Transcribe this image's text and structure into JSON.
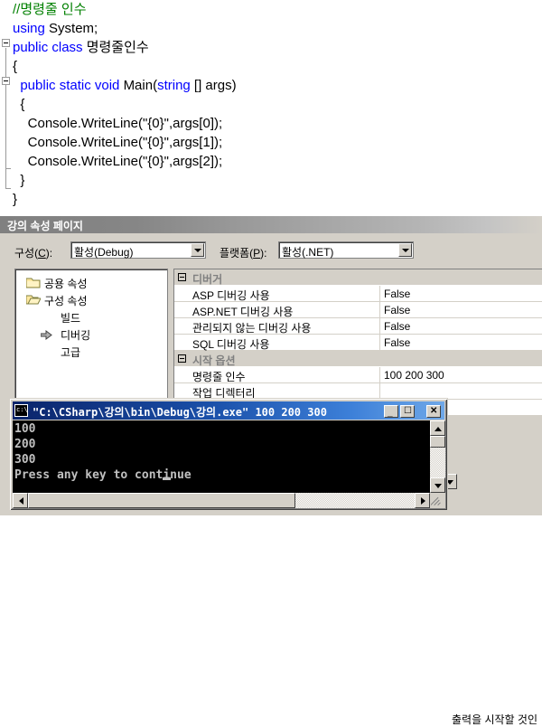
{
  "editor": {
    "name": "code-editor",
    "lines": [
      {
        "indent": 0,
        "segments": [
          {
            "t": "//명령줄 인수",
            "c": "cmt"
          }
        ]
      },
      {
        "indent": 0,
        "segments": [
          {
            "t": "using ",
            "c": "kw"
          },
          {
            "t": "System;",
            "c": "pl"
          }
        ]
      },
      {
        "indent": 0,
        "segments": [
          {
            "t": "public class ",
            "c": "kw"
          },
          {
            "t": "명령줄인수",
            "c": "pl"
          }
        ]
      },
      {
        "indent": 0,
        "segments": [
          {
            "t": "{",
            "c": "pl"
          }
        ]
      },
      {
        "indent": 0,
        "segments": [
          {
            "t": "  public static void ",
            "c": "kw"
          },
          {
            "t": "Main(",
            "c": "pl"
          },
          {
            "t": "string",
            "c": "kw"
          },
          {
            "t": " [] args)",
            "c": "pl"
          }
        ]
      },
      {
        "indent": 0,
        "segments": [
          {
            "t": "  {",
            "c": "pl"
          }
        ]
      },
      {
        "indent": 0,
        "segments": [
          {
            "t": "    Console.WriteLine(\"{0}\",args[0]);",
            "c": "pl"
          }
        ]
      },
      {
        "indent": 0,
        "segments": [
          {
            "t": "    Console.WriteLine(\"{0}\",args[1]);",
            "c": "pl"
          }
        ]
      },
      {
        "indent": 0,
        "segments": [
          {
            "t": "    Console.WriteLine(\"{0}\",args[2]);",
            "c": "pl"
          }
        ]
      },
      {
        "indent": 0,
        "segments": [
          {
            "t": "  }",
            "c": "pl"
          }
        ]
      },
      {
        "indent": 0,
        "segments": [
          {
            "t": "}",
            "c": "pl"
          }
        ]
      }
    ],
    "colors": {
      "keyword": "#0000ff",
      "comment": "#008000",
      "plain": "#000000"
    }
  },
  "property_page": {
    "title": "강의 속성 페이지",
    "config": {
      "configuration_label": "구성(C):",
      "configuration_value": "활성(Debug)",
      "platform_label": "플랫폼(P):",
      "platform_value": "활성(.NET)"
    },
    "tree": {
      "items": [
        {
          "label": "공용 속성",
          "icon": "folder-closed-icon",
          "level": 0,
          "selected": false
        },
        {
          "label": "구성 속성",
          "icon": "folder-open-icon",
          "level": 0,
          "selected": false
        },
        {
          "label": "빌드",
          "icon": "none",
          "level": 1,
          "selected": false
        },
        {
          "label": "디버깅",
          "icon": "arrow-right-icon",
          "level": 1,
          "selected": true
        },
        {
          "label": "고급",
          "icon": "none",
          "level": 1,
          "selected": false
        }
      ]
    },
    "grid": {
      "groups": [
        {
          "name": "디버거",
          "rows": [
            {
              "name": "ASP 디버깅 사용",
              "value": "False"
            },
            {
              "name": "ASP.NET 디버깅 사용",
              "value": "False"
            },
            {
              "name": "관리되지 않는 디버깅 사용",
              "value": "False"
            },
            {
              "name": "SQL 디버깅 사용",
              "value": "False"
            }
          ]
        },
        {
          "name": "시작 옵션",
          "rows": [
            {
              "name": "명령줄 인수",
              "value": "100 200 300"
            },
            {
              "name": "작업 디렉터리",
              "value": ""
            }
          ]
        }
      ]
    },
    "hint_text": "출력을 시작할 것인"
  },
  "console": {
    "title": "\"C:\\CSharp\\강의\\bin\\Debug\\강의.exe\" 100 200 300",
    "icon": "console-app-icon",
    "buttons": {
      "minimize": "_",
      "maximize": "☐",
      "close": "✕"
    },
    "output": "100\n200\n300\nPress any key to continue",
    "lines": [
      "100",
      "200",
      "300",
      "Press any key to continue"
    ],
    "colors": {
      "background": "#000000",
      "text": "#c0c0c0",
      "titlebar": "#0a246a"
    }
  },
  "theme": {
    "window_face": "#d4d0c8",
    "window_shadow": "#808080",
    "window_highlight": "#ffffff",
    "selection_blue": "#0a246a",
    "grid_group_text": "#808080"
  }
}
